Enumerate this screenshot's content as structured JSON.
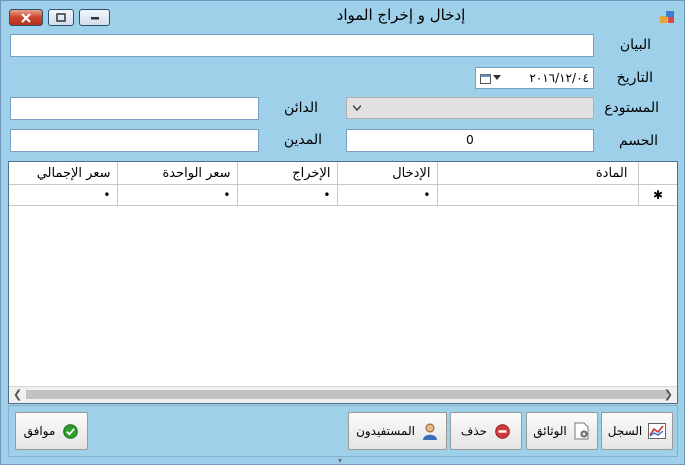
{
  "window": {
    "title": "إدخال و إخراج المواد"
  },
  "form": {
    "statement_label": "البيان",
    "statement_value": "",
    "date_label": "التاريخ",
    "date_value": "٢٠١٦/١٢/٠٤",
    "warehouse_label": "المستودع",
    "warehouse_value": "",
    "creditor_label": "الدائن",
    "creditor_value": "",
    "discount_label": "الحسم",
    "discount_value": "0",
    "debtor_label": "المدين",
    "debtor_value": ""
  },
  "grid": {
    "columns": [
      "المادة",
      "الإدخال",
      "الإخراج",
      "سعر الواحدة",
      "سعر الإجمالي"
    ],
    "new_row_marker": "✱",
    "row_values": [
      "",
      "•",
      "•",
      "•",
      "•"
    ]
  },
  "footer": {
    "record_label": "السجل",
    "documents_label": "الوثائق",
    "delete_label": "حذف",
    "beneficiaries_label": "المستفيدون",
    "ok_label": "موافق"
  },
  "colors": {
    "background": "#9ed0ea",
    "border": "#7a9fc4",
    "ok_green": "#2e9e2e",
    "delete_red": "#d23b3b"
  }
}
